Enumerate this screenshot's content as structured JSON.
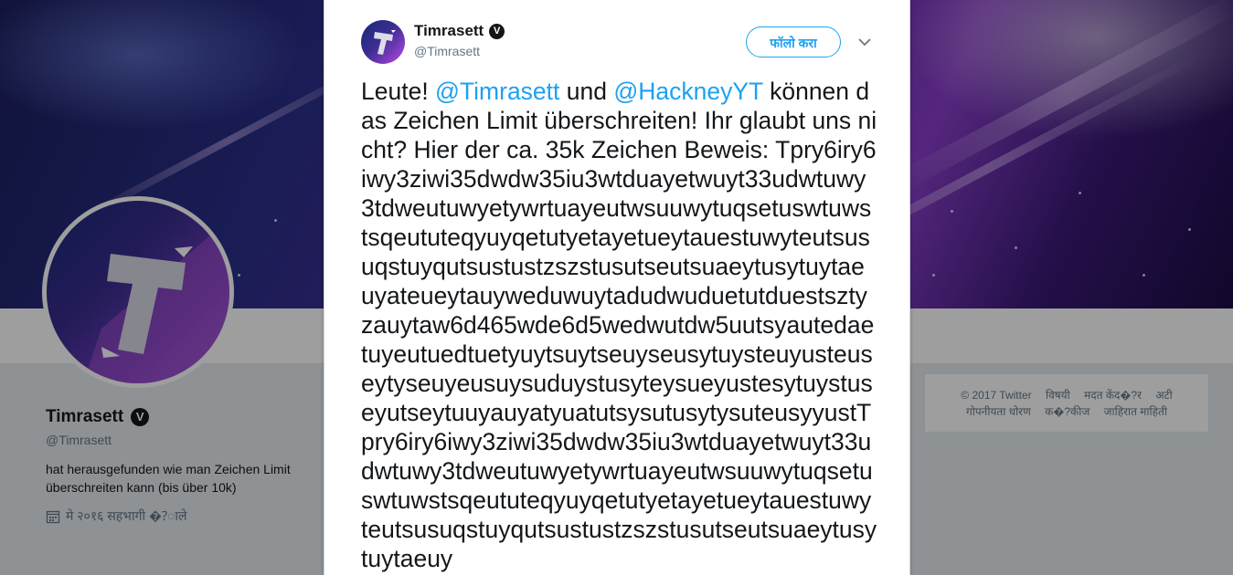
{
  "profile": {
    "name": "Timrasett",
    "handle": "@Timrasett",
    "bio": "hat herausgefunden wie man Zeichen Limit überschreiten kann (bis über 10k)",
    "joined": "मे २०१६ सहभागी �?ाले",
    "verified_glyph": "V"
  },
  "footer": {
    "row1": [
      "© 2017 Twitter",
      "विषयी",
      "मदत केंद�?र",
      "अटी"
    ],
    "row2": [
      "गोपनीयता धोरण",
      "क�?कीज",
      "जाहिरात माहिती"
    ]
  },
  "tweet": {
    "author_name": "Timrasett",
    "author_handle": "@Timrasett",
    "follow_label": "फॉलो करा",
    "chevron_icon": "chevron-down-icon",
    "text_part1": "Leute! ",
    "mention1": "@Timrasett",
    "text_part2": " und ",
    "mention2": "@HackneyYT",
    "text_part3": " können das Zeichen Limit überschreiten! Ihr glaubt uns nicht? Hier der ca. 35k Zeichen Beweis: Tpry6iry6iwy3ziwi35dwdw35iu3wtduayetwuyt33udwtuwy3tdweutuwyetywrtuayeutwsuuwytuqsetuswtuwstsqeututeqyuyqetutyetayetueytauestuwyteutsusuqstuyqutsustustzszstusutseutsuaeytusytuytaeuyateueytauyweduwuytadudwuduetutduestsztyzauytaw6d465wde6d5wedwutdw5uutsyautedaetuyeutuedtuetyuytsuytseuyseusytuysteuyusteuseytyseuyeusuysuduystusyteysueyustesytuystuseyutseytuuyauyatyuatutsysutusytysuteusyyustTpry6iry6iwy3ziwi35dwdw35iu3wtduayetwuyt33udwtuwy3tdweutuwyetywrtuayeutwsuuwytuqsetuswtuwstsqeututeqyuyqetutyetayetueytauestuwyteutsusuqstuyqutsustustzszstusutseutsuaeytusytuytaeuy"
  },
  "colors": {
    "accent": "#1da1f2",
    "text": "#14171a",
    "muted": "#657786"
  }
}
